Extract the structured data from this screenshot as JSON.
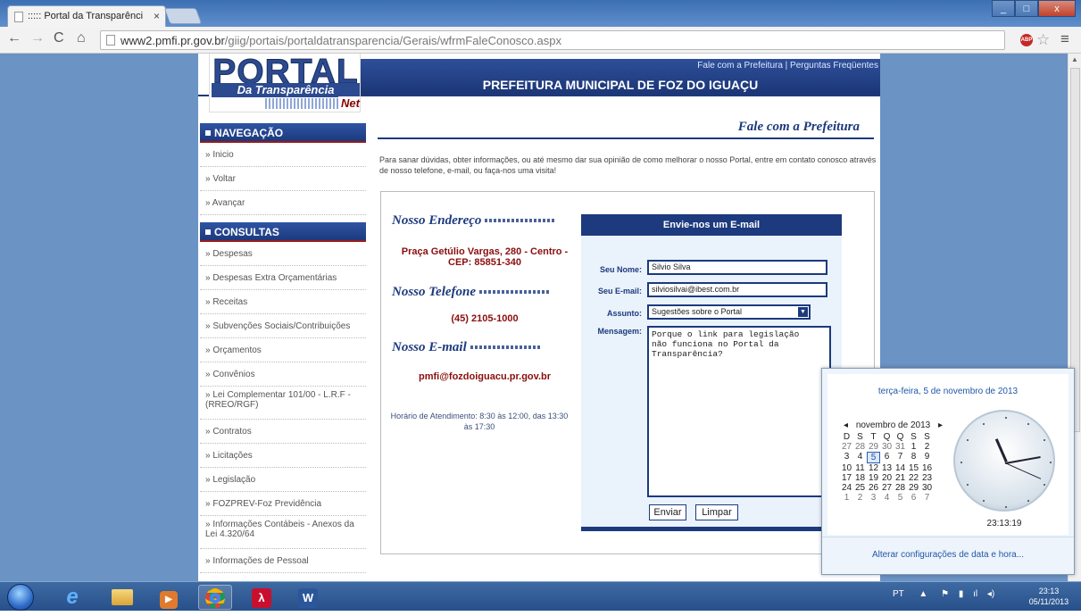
{
  "browser": {
    "tab_title": "::::: Portal da Transparênci",
    "tab_close": "×",
    "url_host": "www2.pmfi.pr.gov.br",
    "url_path": "/giig/portais/portaldatransparencia/Gerais/wfrmFaleConosco.aspx",
    "abp_label": "ABP",
    "win_min": "_",
    "win_max": "□",
    "win_close": "x"
  },
  "site": {
    "logo_main": "PORTAL",
    "logo_sub": "Da Transparência",
    "logo_net": "Net",
    "header_links": "Fale com a Prefeitura | Perguntas Freqüentes",
    "header_title": "PREFEITURA MUNICIPAL DE FOZ DO IGUAÇU"
  },
  "sidebar": {
    "nav_header": "NAVEGAÇÃO",
    "nav_items": [
      "» Inicio",
      "» Voltar",
      "» Avançar"
    ],
    "consultas_header": "CONSULTAS",
    "consultas_items": [
      "» Despesas",
      "» Despesas Extra Orçamentárias",
      "» Receitas",
      "» Subvenções Sociais/Contribuições",
      "» Orçamentos",
      "» Convênios",
      "» Lei Complementar 101/00 - L.R.F - (RREO/RGF)",
      "» Contratos",
      "» Licitações",
      "» Legislação",
      "» FOZPREV-Foz Previdência",
      "» Informações Contábeis - Anexos da Lei 4.320/64",
      "» Informações de Pessoal"
    ]
  },
  "main": {
    "page_title": "Fale com a Prefeitura",
    "intro": "Para sanar dúvidas, obter informações, ou até mesmo dar sua opinião de como melhorar o nosso Portal, entre em contato conosco através de nosso telefone, e-mail, ou faça-nos uma visita!",
    "address_heading": "Nosso Endereço",
    "address_value": "Praça Getúlio Vargas, 280 - Centro - CEP: 85851-340",
    "phone_heading": "Nosso Telefone",
    "phone_value": "(45) 2105-1000",
    "email_heading": "Nosso E-mail",
    "email_value": "pmfi@fozdoiguacu.pr.gov.br",
    "hours": "Horário de Atendimento: 8:30 às 12:00, das 13:30 às 17:30"
  },
  "form": {
    "header": "Envie-nos um E-mail",
    "name_label": "Seu Nome:",
    "name_value": "Silvio Silva",
    "email_label": "Seu E-mail:",
    "email_value": "silviosilvai@ibest.com.br",
    "subject_label": "Assunto:",
    "subject_value": "Sugestões sobre o Portal",
    "message_label": "Mensagem:",
    "message_value": "Porque o link para legislação\nnão funciona no Portal da\nTransparência?",
    "send_label": "Enviar",
    "clear_label": "Limpar"
  },
  "calendar": {
    "long_date": "terça-feira, 5 de novembro de 2013",
    "month_label": "novembro de 2013",
    "prev": "◂",
    "next": "▸",
    "weekdays": [
      "D",
      "S",
      "T",
      "Q",
      "Q",
      "S",
      "S"
    ],
    "weeks": [
      [
        "27",
        "28",
        "29",
        "30",
        "31",
        "1",
        "2"
      ],
      [
        "3",
        "4",
        "5",
        "6",
        "7",
        "8",
        "9"
      ],
      [
        "10",
        "11",
        "12",
        "13",
        "14",
        "15",
        "16"
      ],
      [
        "17",
        "18",
        "19",
        "20",
        "21",
        "22",
        "23"
      ],
      [
        "24",
        "25",
        "26",
        "27",
        "28",
        "29",
        "30"
      ],
      [
        "1",
        "2",
        "3",
        "4",
        "5",
        "6",
        "7"
      ]
    ],
    "today": "5",
    "clock_time": "23:13:19",
    "settings_link": "Alterar configurações de data e hora..."
  },
  "taskbar": {
    "lang": "PT",
    "time": "23:13",
    "date": "05/11/2013"
  }
}
